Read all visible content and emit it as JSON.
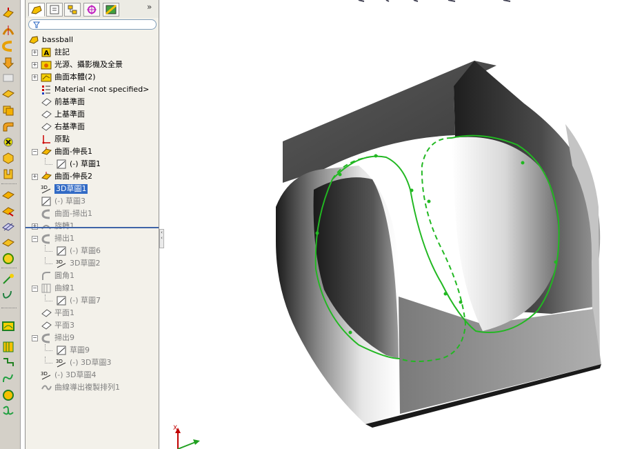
{
  "app": "SolidWorks",
  "feature_tree": {
    "root": "bassball",
    "items": [
      {
        "label": "註記",
        "expand": "+",
        "icon": "annotation-icon",
        "state": "normal",
        "indent": 0
      },
      {
        "label": "光源、攝影機及全景",
        "expand": "+",
        "icon": "lights-cameras-icon",
        "state": "normal",
        "indent": 0
      },
      {
        "label": "曲面本體(2)",
        "expand": "+",
        "icon": "surface-bodies-icon",
        "state": "normal",
        "indent": 0
      },
      {
        "label": "Material <not specified>",
        "expand": "",
        "icon": "material-icon",
        "state": "normal",
        "indent": 0
      },
      {
        "label": "前基準面",
        "expand": "",
        "icon": "plane-icon",
        "state": "normal",
        "indent": 0
      },
      {
        "label": "上基準面",
        "expand": "",
        "icon": "plane-icon",
        "state": "normal",
        "indent": 0
      },
      {
        "label": "右基準面",
        "expand": "",
        "icon": "plane-icon",
        "state": "normal",
        "indent": 0
      },
      {
        "label": "原點",
        "expand": "",
        "icon": "origin-icon",
        "state": "normal",
        "indent": 0
      },
      {
        "label": "曲面-伸長1",
        "expand": "-",
        "icon": "surface-extrude-icon",
        "state": "normal",
        "indent": 0
      },
      {
        "label": "(-) 草圖1",
        "expand": "",
        "icon": "sketch-icon",
        "state": "normal",
        "indent": 1
      },
      {
        "label": "曲面-伸長2",
        "expand": "+",
        "icon": "surface-extrude-icon",
        "state": "normal",
        "indent": 0
      },
      {
        "label": "3D草圖1",
        "expand": "",
        "icon": "sketch3d-icon",
        "state": "selected",
        "indent": 0
      },
      {
        "label": "(-) 草圖3",
        "expand": "",
        "icon": "sketch-icon",
        "state": "suppressed",
        "indent": 0
      },
      {
        "label": "曲面-掃出1",
        "expand": "",
        "icon": "surface-sweep-icon",
        "state": "suppressed",
        "indent": 0
      },
      {
        "label": "旋轉1",
        "expand": "+",
        "icon": "revolve-icon",
        "state": "suppressed",
        "indent": 0
      },
      {
        "label": "掃出1",
        "expand": "-",
        "icon": "sweep-icon",
        "state": "suppressed",
        "indent": 0
      },
      {
        "label": "(-) 草圖6",
        "expand": "",
        "icon": "sketch-icon",
        "state": "suppressed",
        "indent": 1
      },
      {
        "label": "3D草圖2",
        "expand": "",
        "icon": "sketch3d-icon",
        "state": "suppressed",
        "indent": 1
      },
      {
        "label": "圓角1",
        "expand": "",
        "icon": "fillet-icon",
        "state": "suppressed",
        "indent": 0
      },
      {
        "label": "曲線1",
        "expand": "-",
        "icon": "curve-icon",
        "state": "suppressed",
        "indent": 0
      },
      {
        "label": "(-) 草圖7",
        "expand": "",
        "icon": "sketch-icon",
        "state": "suppressed",
        "indent": 1
      },
      {
        "label": "平面1",
        "expand": "",
        "icon": "plane-icon",
        "state": "suppressed",
        "indent": 0
      },
      {
        "label": "平面3",
        "expand": "",
        "icon": "plane-icon",
        "state": "suppressed",
        "indent": 0
      },
      {
        "label": "掃出9",
        "expand": "-",
        "icon": "sweep-icon",
        "state": "suppressed",
        "indent": 0
      },
      {
        "label": "草圖9",
        "expand": "",
        "icon": "sketch-icon",
        "state": "suppressed",
        "indent": 1
      },
      {
        "label": "(-) 3D草圖3",
        "expand": "",
        "icon": "sketch3d-icon",
        "state": "suppressed",
        "indent": 1
      },
      {
        "label": "(-) 3D草圖4",
        "expand": "",
        "icon": "sketch3d-icon",
        "state": "suppressed",
        "indent": 0
      },
      {
        "label": "曲線導出複製排列1",
        "expand": "",
        "icon": "curve-pattern-icon",
        "state": "suppressed",
        "indent": 0
      }
    ]
  },
  "triad": {
    "x_label": "X"
  },
  "colors": {
    "selection": "#316ac5",
    "sketch_green": "#22b822",
    "rollback_bar": "#3e63a7"
  }
}
